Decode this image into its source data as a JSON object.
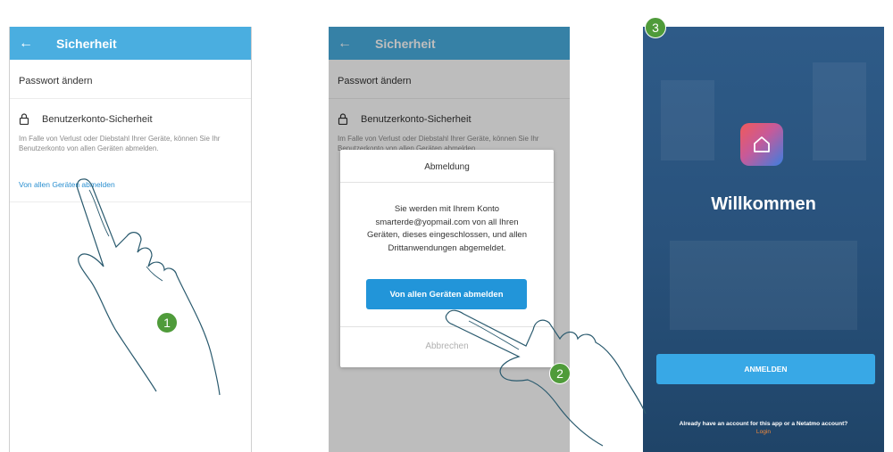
{
  "colors": {
    "header_blue": "#4aaee0",
    "link_blue": "#2a8fd0",
    "button_blue": "#2295d9",
    "badge_green": "#4f9b3a",
    "login_orange": "#f08a3c"
  },
  "screen1": {
    "header": {
      "back_icon": "←",
      "title": "Sicherheit"
    },
    "password_change": "Passwort ändern",
    "account_security": {
      "icon": "lock-icon",
      "label": "Benutzerkonto-Sicherheit"
    },
    "description": "Im Falle von Verlust oder Diebstahl Ihrer Geräte, können Sie Ihr Benutzerkonto von allen Geräten abmelden.",
    "logout_all_link": "Von allen Geräten abmelden"
  },
  "screen2": {
    "header": {
      "back_icon": "←",
      "title": "Sicherheit"
    },
    "password_change": "Passwort ändern",
    "account_security": {
      "icon": "lock-icon",
      "label": "Benutzerkonto-Sicherheit"
    },
    "description": "Im Falle von Verlust oder Diebstahl Ihrer Geräte, können Sie Ihr Benutzerkonto von allen Geräten abmelden.",
    "dialog": {
      "title": "Abmeldung",
      "message": "Sie werden mit Ihrem Konto smarterde@yopmail.com von all Ihren Geräten, dieses eingeschlossen, und allen Drittanwendungen abgemeldet.",
      "confirm_button": "Von allen Geräten abmelden",
      "cancel_button": "Abbrechen"
    }
  },
  "screen3": {
    "app_icon": "home-icon",
    "welcome": "Willkommen",
    "login_button": "ANMELDEN",
    "account_question": "Already have an account for this app or a Netatmo account?",
    "login_link": "Login"
  },
  "steps": [
    "1",
    "2",
    "3"
  ]
}
